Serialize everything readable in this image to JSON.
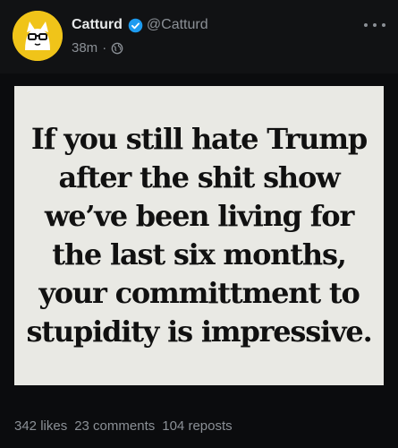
{
  "post": {
    "author": {
      "name": "Catturd",
      "handle": "@Catturd",
      "verified": true
    },
    "time": "38m",
    "separator": "·",
    "visibility_icon": "globe-icon",
    "more_icon": "more-icon",
    "image_text_lines": [
      "If you still hate Trump",
      "after the shit show",
      "we’ve been living for",
      "the last six months,",
      "your committment to",
      "stupidity is impressive."
    ],
    "stats": {
      "likes": "342 likes",
      "comments": "23 comments",
      "reposts": "104 reposts"
    }
  },
  "colors": {
    "background": "#0b0c0e",
    "verified_badge": "#1d9bf0",
    "muted_text": "#8b9096",
    "avatar_bg": "#f0c419"
  }
}
